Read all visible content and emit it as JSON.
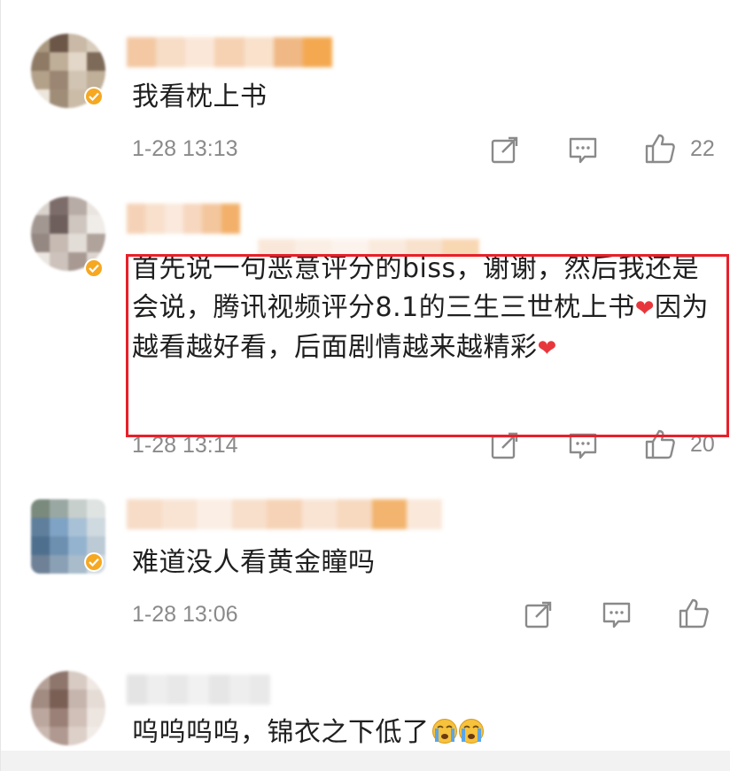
{
  "comments": [
    {
      "text": "我看枕上书",
      "timestamp": "1-28 13:13",
      "likes": "22",
      "avatar_colors": [
        "#a9987f",
        "#6b5648",
        "#c9b9a6",
        "#d8ccbb",
        "#8f7a65",
        "#bfae98",
        "#e2d7c8",
        "#7e6a58",
        "#b3a18a",
        "#9a8672",
        "#d1c4b2",
        "#c0af99",
        "#ede6dc",
        "#a08d78",
        "#cbbca8",
        "#e0d6c8"
      ],
      "name_colors": [
        "#f3c8a3",
        "#f7dcc6",
        "#fbe7d8",
        "#f6d2b3",
        "#f9e1cc",
        "#f0b884",
        "#f4a84f"
      ]
    },
    {
      "text": "首先说一句恶意评分的biss，谢谢，然后我还是会说，腾讯视频评分8.1的三生三世枕上书",
      "text_mid": "因为越看越好看，后面剧情越来越精彩",
      "timestamp": "1-28 13:14",
      "likes": "20",
      "avatar_colors": [
        "#d9d2cc",
        "#7d6d6a",
        "#b8aca6",
        "#e9e4df",
        "#a39791",
        "#6e5f5d",
        "#cfc6bf",
        "#f0ece8",
        "#958883",
        "#c6bab3",
        "#e3ddd7",
        "#b0a39c",
        "#ebe6e1",
        "#cdc3bc",
        "#a89a93",
        "#ddd6d0"
      ],
      "name_colors": [
        "#f5d2b7",
        "#f8e0cc",
        "#fae9dc",
        "#f7d7bf",
        "#f3c69d",
        "#f2b06a"
      ]
    },
    {
      "text": "难道没人看黄金瞳吗",
      "timestamp": "1-28 13:06",
      "likes": "",
      "avatar_colors": [
        "#7a8a7c",
        "#9aa8a4",
        "#c7cfcc",
        "#dfe4e2",
        "#5f7f9c",
        "#7fa3c4",
        "#a9c1d6",
        "#cfd9e0",
        "#4f6f8f",
        "#6d8fb0",
        "#93b3cf",
        "#bccad6",
        "#6e8196",
        "#8aa0b5",
        "#a8bccb",
        "#d2dbe2"
      ],
      "name_colors": [
        "#f7dcc7",
        "#f9e4d4",
        "#fbeee4",
        "#f8dfcb",
        "#f6d3b6",
        "#f9e4d4",
        "#f7d9c0",
        "#f2b46e",
        "#fae8da"
      ]
    },
    {
      "text": "呜呜呜呜，锦衣之下低了",
      "timestamp": "",
      "likes": "",
      "avatar_colors": [
        "#b4a097",
        "#8e766c",
        "#d8cbc4",
        "#efe8e3",
        "#a28b81",
        "#7a5f55",
        "#c6b5ad",
        "#e6dcd6",
        "#bca79e",
        "#9a8076",
        "#d0c0b8",
        "#ede5e0",
        "#c9b8b0",
        "#b09990",
        "#ddd0c9",
        "#f2ece8"
      ],
      "name_colors": [
        "#e4e4e4",
        "#eeeeee",
        "#e8e8e8",
        "#f1f1f1",
        "#e6e6e6",
        "#eeeeee",
        "#e9e9e9"
      ]
    }
  ],
  "icons": {
    "repost": "repost-icon",
    "comment": "comment-icon",
    "like": "thumbs-up-icon",
    "verified": "verified-badge-icon",
    "heart": "heart-emoji",
    "crying": "crying-face-emoji"
  },
  "colors": {
    "highlight_border": "#e8202a",
    "text": "#1f1f1f",
    "meta": "#8a8a8a",
    "verified": "#f6a821"
  }
}
